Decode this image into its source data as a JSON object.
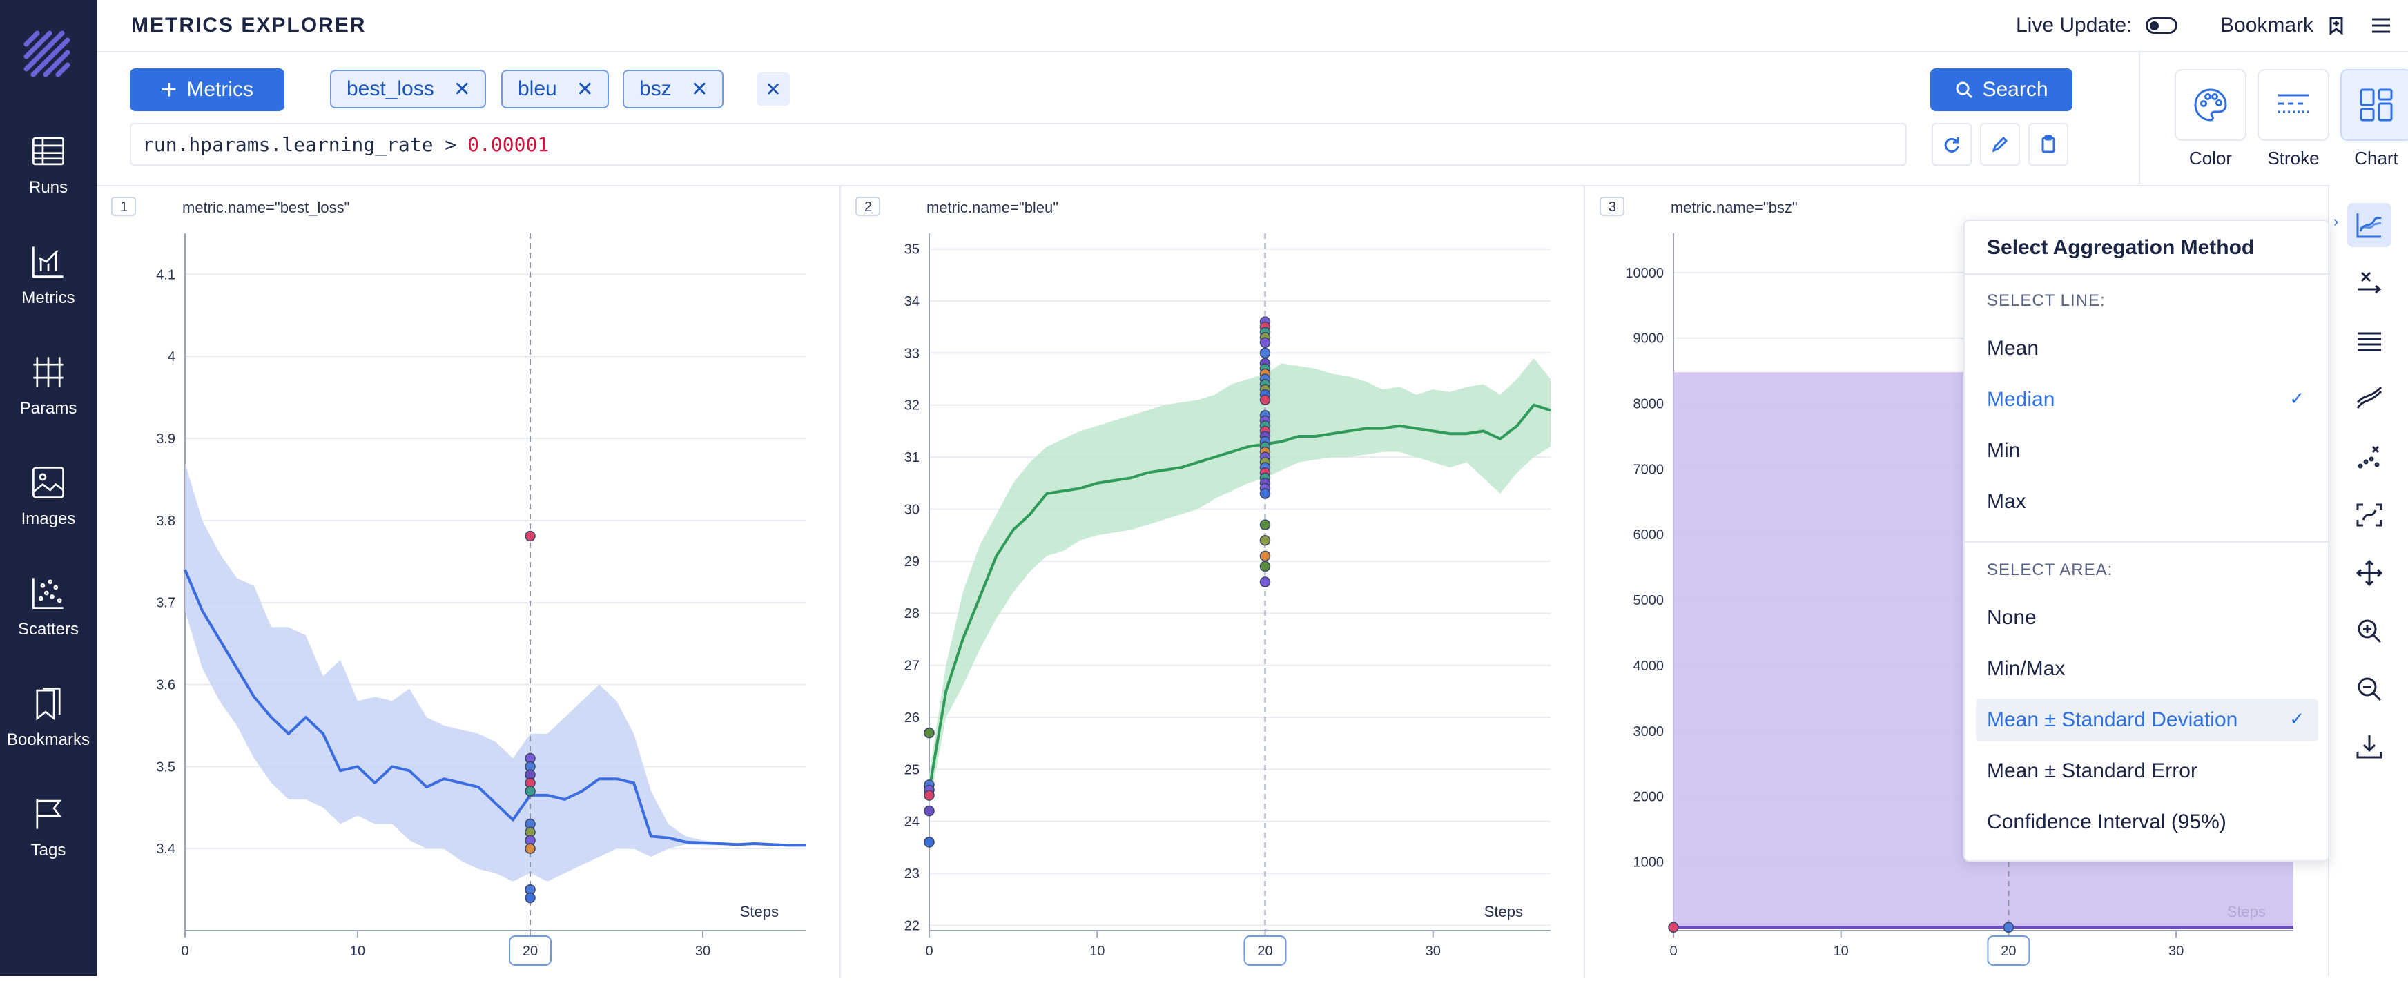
{
  "header": {
    "title": "METRICS EXPLORER",
    "live_update_label": "Live Update:",
    "bookmark_label": "Bookmark"
  },
  "sidebar": {
    "items": [
      {
        "label": "Runs",
        "icon": "table-icon"
      },
      {
        "label": "Metrics",
        "icon": "line-chart-icon"
      },
      {
        "label": "Params",
        "icon": "params-icon"
      },
      {
        "label": "Images",
        "icon": "image-icon"
      },
      {
        "label": "Scatters",
        "icon": "scatter-icon"
      },
      {
        "label": "Bookmarks",
        "icon": "bookmark-icon"
      },
      {
        "label": "Tags",
        "icon": "flag-icon"
      }
    ]
  },
  "toolbar": {
    "metrics_button": "Metrics",
    "chips": [
      "best_loss",
      "bleu",
      "bsz"
    ],
    "search_button": "Search",
    "query": {
      "prefix": "run.hparams.learning_rate >",
      "value": "0.00001"
    }
  },
  "config": {
    "color_label": "Color",
    "stroke_label": "Stroke",
    "chart_label": "Chart"
  },
  "charts": [
    {
      "index": "1",
      "title": "metric.name=\"best_loss\""
    },
    {
      "index": "2",
      "title": "metric.name=\"bleu\""
    },
    {
      "index": "3",
      "title": "metric.name=\"bsz\""
    }
  ],
  "aggregation": {
    "title": "Select Aggregation Method",
    "line_section": "SELECT LINE:",
    "line_options": [
      "Mean",
      "Median",
      "Min",
      "Max"
    ],
    "line_selected": "Median",
    "area_section": "SELECT AREA:",
    "area_options": [
      "None",
      "Min/Max",
      "Mean ± Standard Deviation",
      "Mean ± Standard Error",
      "Confidence Interval (95%)"
    ],
    "area_selected": "Mean ± Standard Deviation"
  },
  "chart_data": [
    {
      "type": "line",
      "title": "metric.name=\"best_loss\"",
      "xlabel": "Steps",
      "xlim": [
        0,
        36
      ],
      "ylim": [
        3.3,
        4.15
      ],
      "x_ticks": [
        0,
        10,
        20,
        30
      ],
      "y_ticks": [
        3.4,
        3.5,
        3.6,
        3.7,
        3.8,
        3.9,
        4,
        4.1
      ],
      "y_tick_labels": [
        "3.4",
        "3.5",
        "3.6",
        "3.7",
        "3.8",
        "3.9",
        "4",
        "4.1"
      ],
      "cursor_step": 20,
      "color": "#3b6de0",
      "band_color": "#c7d4f4",
      "x": [
        0,
        1,
        2,
        3,
        4,
        5,
        6,
        7,
        8,
        9,
        10,
        11,
        12,
        13,
        14,
        15,
        16,
        17,
        18,
        19,
        20,
        21,
        22,
        23,
        24,
        25,
        26,
        27,
        28,
        29,
        30,
        31,
        32,
        33,
        34,
        35,
        36
      ],
      "line": [
        3.74,
        3.69,
        3.655,
        3.62,
        3.585,
        3.56,
        3.54,
        3.56,
        3.54,
        3.495,
        3.5,
        3.48,
        3.5,
        3.495,
        3.475,
        3.485,
        3.48,
        3.475,
        3.455,
        3.435,
        3.465,
        3.465,
        3.46,
        3.47,
        3.485,
        3.485,
        3.48,
        3.415,
        3.413,
        3.408,
        3.407,
        3.406,
        3.405,
        3.406,
        3.405,
        3.404,
        3.404
      ],
      "upper": [
        3.87,
        3.8,
        3.76,
        3.73,
        3.72,
        3.67,
        3.67,
        3.66,
        3.61,
        3.63,
        3.58,
        3.585,
        3.58,
        3.595,
        3.56,
        3.55,
        3.545,
        3.54,
        3.53,
        3.51,
        3.54,
        3.54,
        3.56,
        3.58,
        3.6,
        3.58,
        3.54,
        3.47,
        3.43,
        3.415,
        3.41,
        3.408,
        3.406,
        3.406,
        3.405,
        3.404,
        3.404
      ],
      "lower": [
        3.69,
        3.62,
        3.58,
        3.55,
        3.51,
        3.48,
        3.46,
        3.46,
        3.45,
        3.43,
        3.44,
        3.43,
        3.43,
        3.41,
        3.4,
        3.4,
        3.385,
        3.375,
        3.37,
        3.36,
        3.37,
        3.36,
        3.37,
        3.38,
        3.39,
        3.4,
        3.4,
        3.39,
        3.4,
        3.405,
        3.404,
        3.404,
        3.404,
        3.404,
        3.404,
        3.404,
        3.404
      ],
      "cursor_points": [
        3.781,
        3.51,
        3.5,
        3.49,
        3.48,
        3.47,
        3.43,
        3.42,
        3.41,
        3.4,
        3.35,
        3.34
      ],
      "cursor_point_colors": [
        "#d9436a",
        "#7a5bd6",
        "#4c7bd9",
        "#6d4fc4",
        "#d9436a",
        "#3d9c8a",
        "#4c7bd9",
        "#8a9a47",
        "#7a5bd6",
        "#d98a3d",
        "#4c7bd9",
        "#3d6fd9"
      ]
    },
    {
      "type": "line",
      "title": "metric.name=\"bleu\"",
      "xlabel": "Steps",
      "xlim": [
        0,
        37
      ],
      "ylim": [
        21.9,
        35.3
      ],
      "x_ticks": [
        0,
        10,
        20,
        30
      ],
      "y_ticks": [
        22,
        23,
        24,
        25,
        26,
        27,
        28,
        29,
        30,
        31,
        32,
        33,
        34,
        35
      ],
      "y_tick_labels": [
        "22",
        "23",
        "24",
        "25",
        "26",
        "27",
        "28",
        "29",
        "30",
        "31",
        "32",
        "33",
        "34",
        "35"
      ],
      "cursor_step": 20,
      "color": "#2f9a5a",
      "band_color": "#bfe6cd",
      "x": [
        0,
        1,
        2,
        3,
        4,
        5,
        6,
        7,
        8,
        9,
        10,
        11,
        12,
        13,
        14,
        15,
        16,
        17,
        18,
        19,
        20,
        21,
        22,
        23,
        24,
        25,
        26,
        27,
        28,
        29,
        30,
        31,
        32,
        33,
        34,
        35,
        36,
        37
      ],
      "line": [
        24.6,
        26.5,
        27.5,
        28.3,
        29.1,
        29.6,
        29.9,
        30.3,
        30.35,
        30.4,
        30.5,
        30.55,
        30.6,
        30.7,
        30.75,
        30.8,
        30.9,
        31.0,
        31.1,
        31.2,
        31.25,
        31.3,
        31.4,
        31.4,
        31.45,
        31.5,
        31.55,
        31.55,
        31.6,
        31.55,
        31.5,
        31.45,
        31.45,
        31.5,
        31.35,
        31.6,
        32.0,
        31.9
      ],
      "upper": [
        24.9,
        27.0,
        28.4,
        29.3,
        29.9,
        30.5,
        30.9,
        31.2,
        31.35,
        31.5,
        31.6,
        31.7,
        31.8,
        31.9,
        32.0,
        32.05,
        32.1,
        32.2,
        32.4,
        32.5,
        32.6,
        32.8,
        32.75,
        32.7,
        32.6,
        32.55,
        32.45,
        32.3,
        32.35,
        32.2,
        32.3,
        32.25,
        32.35,
        32.4,
        32.2,
        32.5,
        32.9,
        32.5
      ],
      "lower": [
        24.3,
        26.0,
        26.6,
        27.3,
        27.9,
        28.4,
        28.8,
        29.1,
        29.2,
        29.4,
        29.5,
        29.55,
        29.6,
        29.7,
        29.8,
        29.9,
        30.0,
        30.2,
        30.35,
        30.5,
        30.6,
        30.75,
        30.9,
        30.95,
        31.0,
        31.0,
        31.05,
        31.1,
        31.1,
        31.0,
        30.9,
        30.8,
        30.9,
        30.6,
        30.3,
        30.7,
        31.0,
        31.2
      ],
      "start_points": [
        25.7,
        24.7,
        24.6,
        24.5,
        24.2,
        23.6
      ],
      "start_point_colors": [
        "#5a8c3d",
        "#4c7bd9",
        "#7a5bd6",
        "#d9436a",
        "#6d4fc4",
        "#3d6fd9"
      ],
      "cursor_points": [
        33.6,
        33.5,
        33.4,
        33.3,
        33.2,
        33.0,
        32.8,
        32.7,
        32.6,
        32.5,
        32.4,
        32.3,
        32.2,
        32.1,
        31.8,
        31.7,
        31.6,
        31.5,
        31.4,
        31.3,
        31.2,
        31.1,
        31.0,
        30.9,
        30.8,
        30.7,
        30.6,
        30.5,
        30.4,
        30.3,
        29.7,
        29.4,
        29.1,
        28.9,
        28.6
      ],
      "cursor_point_colors": [
        "#7a5bd6",
        "#d9436a",
        "#3d9c8a",
        "#8a9a47",
        "#7a5bd6",
        "#4c7bd9",
        "#6d4fc4",
        "#3d9c8a",
        "#d98a3d",
        "#4c7bd9",
        "#3d9c8a",
        "#8a9a47",
        "#3d6fd9",
        "#d9436a",
        "#4c7bd9",
        "#7a5bd6",
        "#3d9c8a",
        "#d9436a",
        "#6d4fc4",
        "#4c7bd9",
        "#3d9c8a",
        "#d98a3d",
        "#7a5bd6",
        "#8a9a47",
        "#4c7bd9",
        "#d9436a",
        "#3d9c8a",
        "#6d4fc4",
        "#7a5bd6",
        "#3d6fd9",
        "#5a8c3d",
        "#8a9a47",
        "#d98a3d",
        "#5a8c3d",
        "#7a5bd6"
      ]
    },
    {
      "type": "area",
      "title": "metric.name=\"bsz\"",
      "xlabel": "Steps",
      "xlim": [
        0,
        37
      ],
      "ylim": [
        -50,
        10600
      ],
      "x_ticks": [
        0,
        10,
        20,
        30
      ],
      "y_ticks": [
        1000,
        2000,
        3000,
        4000,
        5000,
        6000,
        7000,
        8000,
        9000,
        10000
      ],
      "y_tick_labels": [
        "1000",
        "2000",
        "3000",
        "4000",
        "5000",
        "6000",
        "7000",
        "8000",
        "9000",
        "10000"
      ],
      "cursor_step": 20,
      "color": "#6d4fc4",
      "band_color": "#cbbdf0",
      "x": [
        0,
        37
      ],
      "line": [
        0,
        0
      ],
      "upper": [
        8480,
        8480
      ],
      "lower": [
        0,
        0
      ]
    }
  ]
}
